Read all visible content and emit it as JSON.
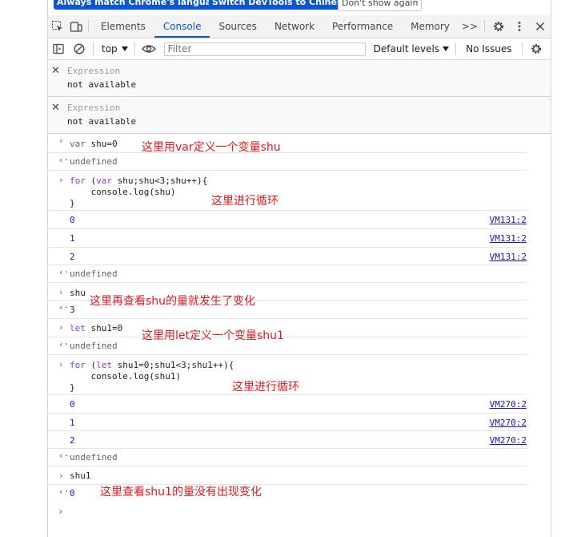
{
  "banner": {
    "btn1": "Always match Chrome's language",
    "btn2": "Switch DevTools to Chinese",
    "btn3": "Don't show again"
  },
  "tabs": [
    "Elements",
    "Console",
    "Sources",
    "Network",
    "Performance",
    "Memory"
  ],
  "more_tabs": ">>",
  "toolbar": {
    "context": "top",
    "filter_placeholder": "Filter",
    "levels": "Default levels",
    "issues": "No Issues"
  },
  "expressions": [
    {
      "label": "Expression",
      "value": "not available"
    },
    {
      "label": "Expression",
      "value": "not available"
    }
  ],
  "console": {
    "m1": {
      "kw": "var",
      "rest": " shu=0"
    },
    "r1": "undefined",
    "m2": {
      "l1kw": "for",
      "l1a": " (",
      "l1kw2": "var",
      "l1b": " shu;shu<3;shu++){",
      "l2": "    console.log(shu)",
      "l3": "}"
    },
    "logs1": [
      {
        "value": "0",
        "source": "VM131:2"
      },
      {
        "value": "1",
        "source": "VM131:2"
      },
      {
        "value": "2",
        "source": "VM131:2"
      }
    ],
    "r2": "undefined",
    "m3": "shu",
    "r3": "3",
    "m4": {
      "kw": "let",
      "rest": " shu1=0"
    },
    "r4": "undefined",
    "m5": {
      "l1kw": "for",
      "l1a": " (",
      "l1kw2": "let",
      "l1b": " shu1=0;shu1<3;shu1++){",
      "l2": "    console.log(shu1)",
      "l3": "}"
    },
    "logs2": [
      {
        "value": "0",
        "source": "VM270:2"
      },
      {
        "value": "1",
        "source": "VM270:2"
      },
      {
        "value": "2",
        "source": "VM270:2"
      }
    ],
    "r5": "undefined",
    "m6": "shu1",
    "r6": "0"
  },
  "annotations": {
    "a1": "这里用var定义一个变量shu",
    "a2": "这里进行循环",
    "a3": "这里再查看shu的量就发生了变化",
    "a4": "这里用let定义一个变量shu1",
    "a5": "这里进行循环",
    "a6": "这里查看shu1的量没有出现变化"
  },
  "colors": {
    "accent": "#0b57d0",
    "annotation": "#e0191f",
    "keyword": "#1a1aa6"
  }
}
